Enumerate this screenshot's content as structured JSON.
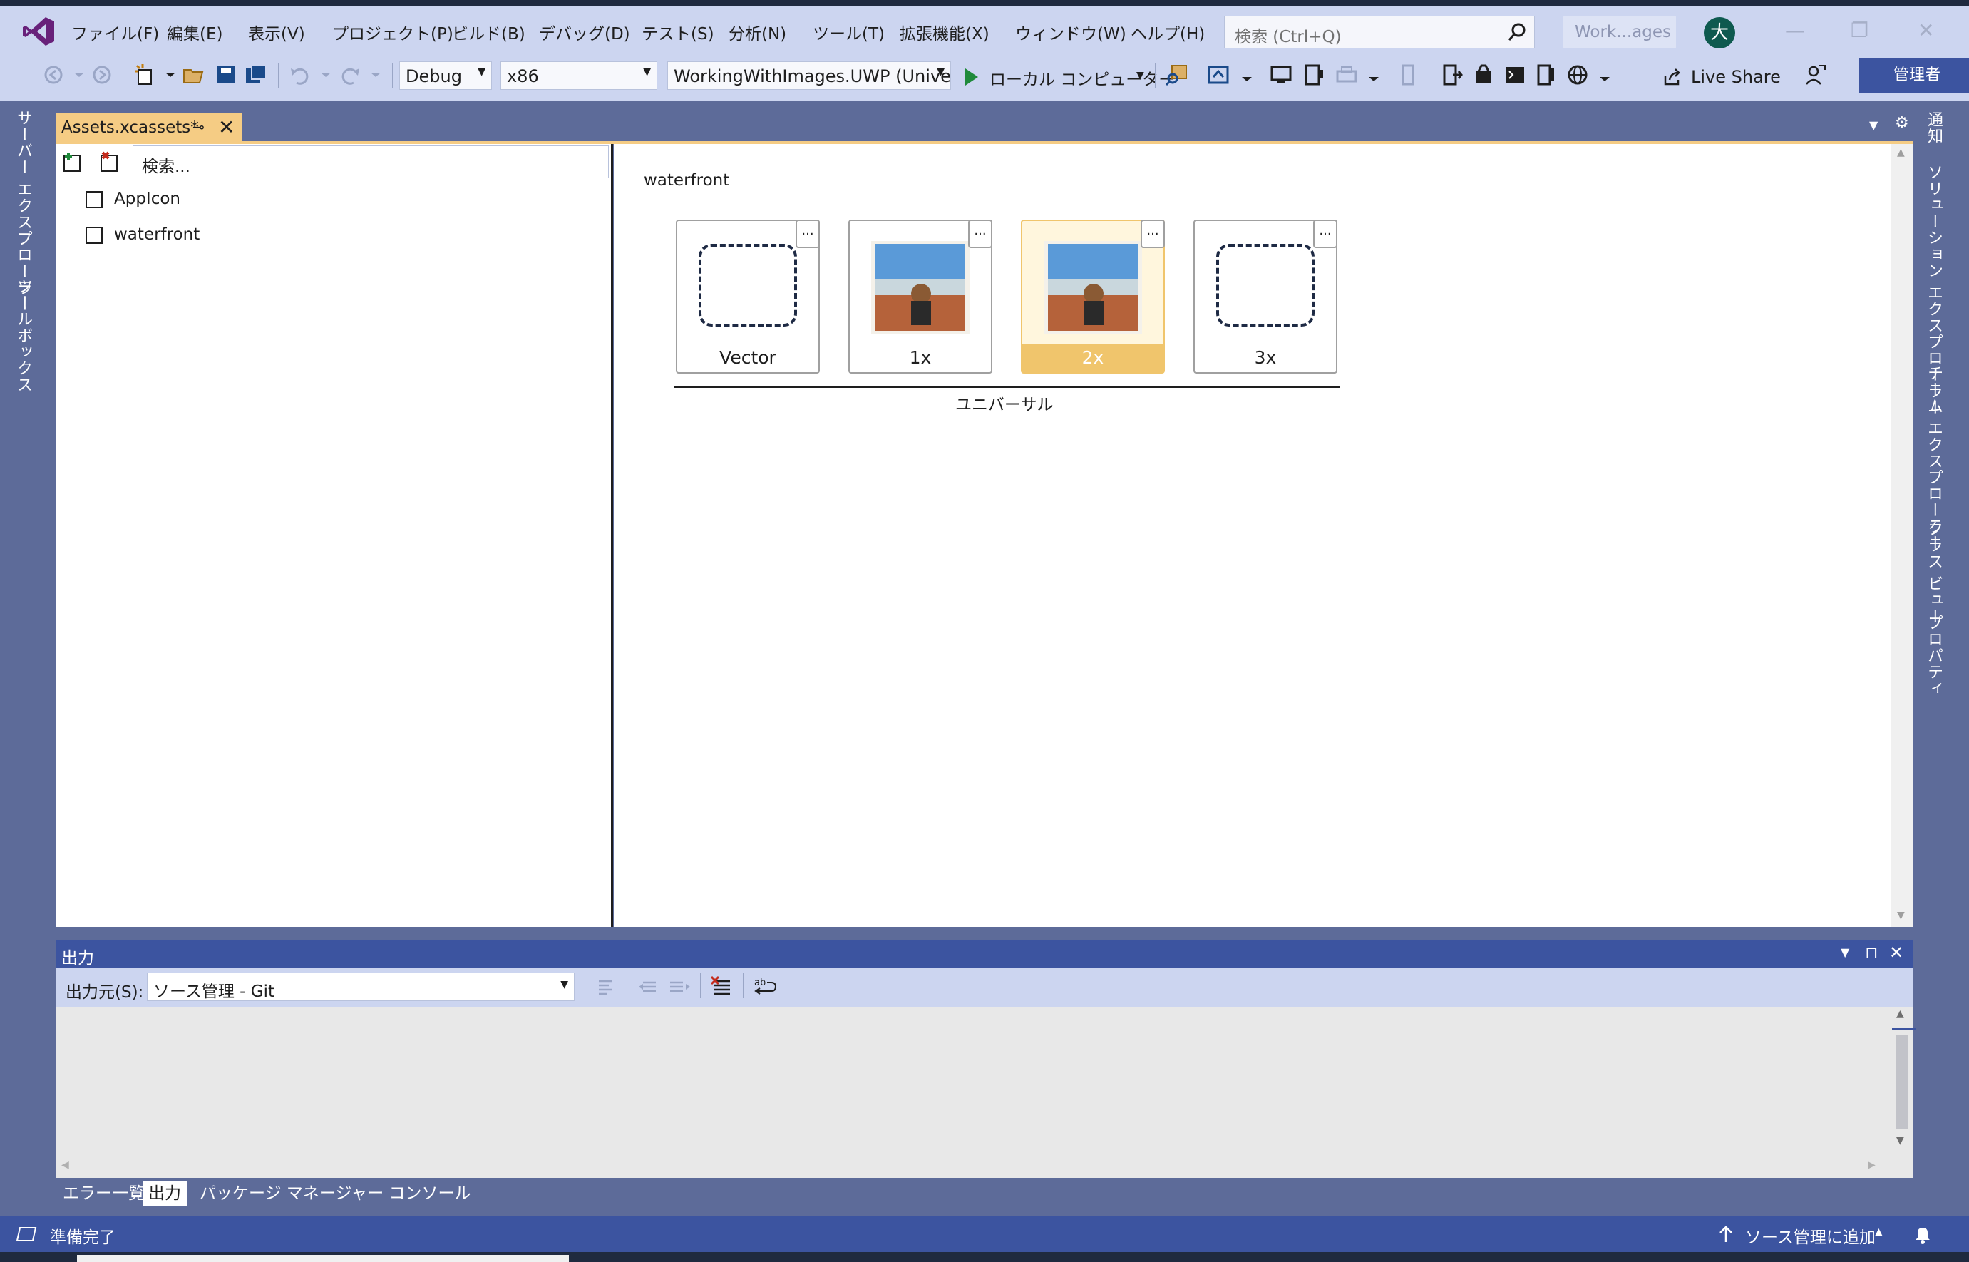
{
  "menu": {
    "items": [
      "ファイル(F)",
      "編集(E)",
      "表示(V)",
      "プロジェクト(P)",
      "ビルド(B)",
      "デバッグ(D)",
      "テスト(S)",
      "分析(N)",
      "ツール(T)",
      "拡張機能(X)",
      "ウィンドウ(W)",
      "ヘルプ(H)"
    ],
    "search_placeholder": "検索 (Ctrl+Q)",
    "solution_name": "Work...ages",
    "avatar_initial": "大"
  },
  "toolbar": {
    "config": "Debug",
    "platform": "x86",
    "startup_project": "WorkingWithImages.UWP (Univers",
    "run_target": "ローカル コンピューター",
    "live_share": "Live Share",
    "admin": "管理者"
  },
  "left_strip": [
    "サーバー エクスプローラー",
    "ツールボックス"
  ],
  "right_strip": [
    "通知",
    "ソリューション エクスプローラー",
    "チーム エクスプローラー",
    "クラス ビュー",
    "プロパティ"
  ],
  "document": {
    "tab_title": "Assets.xcassets*",
    "search": "検索...",
    "tree": [
      "AppIcon",
      "waterfront"
    ],
    "set_title": "waterfront",
    "slots": [
      {
        "label": "Vector",
        "has_image": false,
        "selected": false,
        "menu": "..."
      },
      {
        "label": "1x",
        "has_image": true,
        "selected": false,
        "menu": "..."
      },
      {
        "label": "2x",
        "has_image": true,
        "selected": true,
        "menu": "..."
      },
      {
        "label": "3x",
        "has_image": false,
        "selected": false,
        "menu": "..."
      }
    ],
    "group_label": "ユニバーサル"
  },
  "output": {
    "title": "出力",
    "source_label": "出力元(S):",
    "source_value": "ソース管理 - Git"
  },
  "bottom_tabs": [
    "エラー一覧",
    "出力",
    "パッケージ マネージャー コンソール"
  ],
  "status": {
    "left": "準備完了",
    "right": "ソース管理に追加"
  },
  "colors": {
    "chrome": "#5d6b99",
    "menubar": "#ccd5f0",
    "accent": "#3c54a0",
    "tab_active": "#f5cc84",
    "selected_slot": "#f0c56c"
  }
}
